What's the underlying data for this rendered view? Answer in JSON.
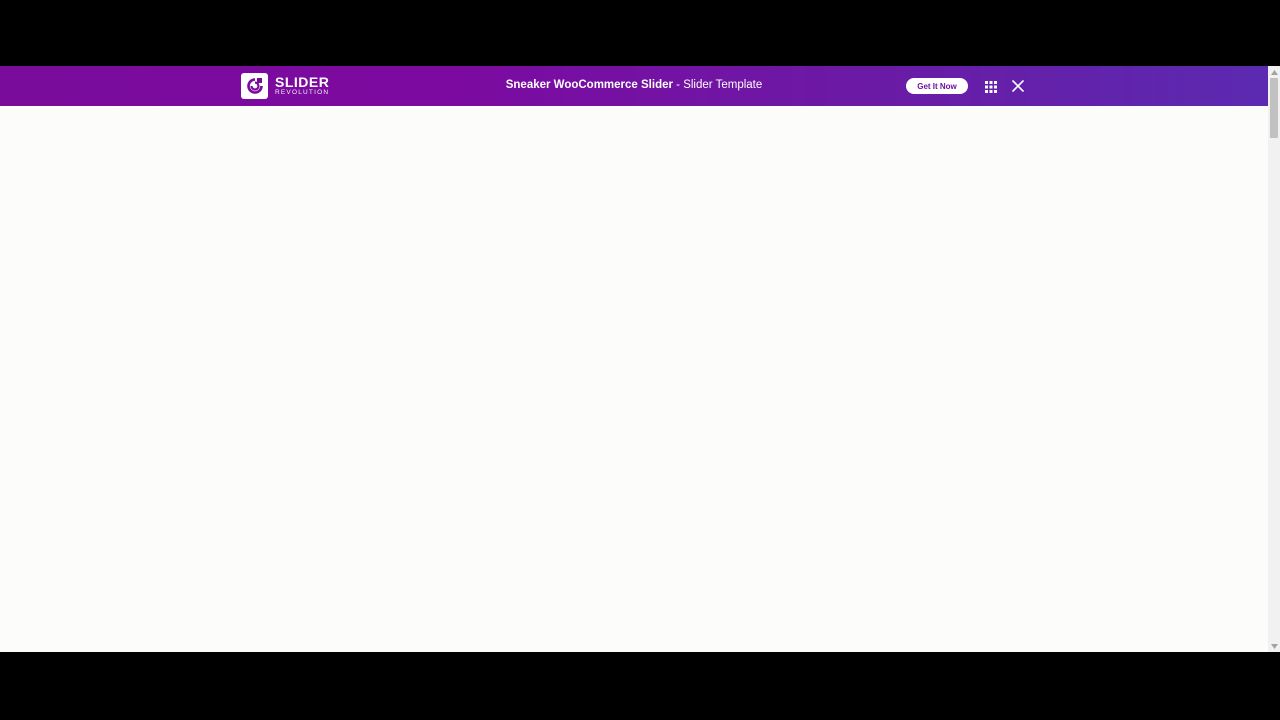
{
  "topbar": {
    "logo": {
      "title": "SLIDER",
      "subtitle": "REVOLUTION",
      "icon": "slider-revolution-logo-icon"
    },
    "title_bold": "Sneaker WooCommerce Slider",
    "title_rest": " - Slider Template",
    "cta_label": "Get It Now",
    "grid_icon": "grid-icon",
    "close_icon": "close-icon",
    "colors": {
      "gradient_start": "#7a0c9c",
      "gradient_end": "#5b2ab0",
      "button_text": "#6a14a2"
    }
  },
  "content": {
    "background": "#fcfcfa"
  }
}
